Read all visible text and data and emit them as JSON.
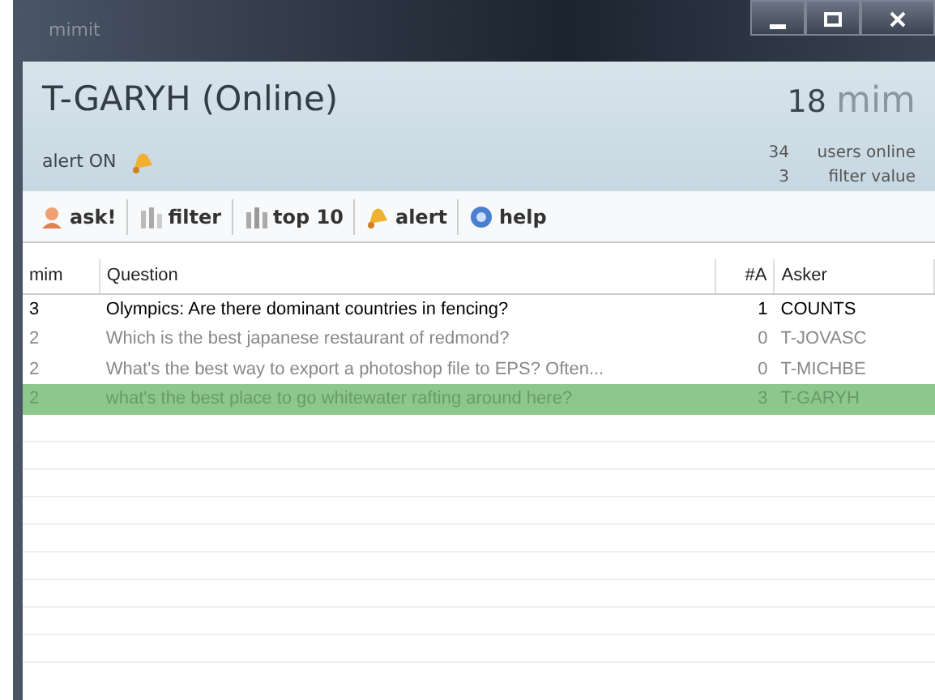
{
  "window": {
    "title": "mimit"
  },
  "header": {
    "user": "T-GARYH (Online)",
    "alert_status": "alert ON",
    "mim_count": "18",
    "logo": "mim",
    "stats": [
      {
        "value": "34",
        "label": "users online"
      },
      {
        "value": "3",
        "label": "filter value"
      }
    ]
  },
  "toolbar": [
    {
      "label": "ask!",
      "kind": "ask"
    },
    {
      "label": "filter",
      "kind": "filter"
    },
    {
      "label": "top 10",
      "kind": "top"
    },
    {
      "label": "alert",
      "kind": "alert"
    },
    {
      "label": "help",
      "kind": "help"
    }
  ],
  "table": {
    "columns": [
      "mim",
      "Question",
      "#A",
      "Asker"
    ],
    "rows": [
      {
        "mim": "3",
        "question": "Olympics: Are there dominant countries in fencing?",
        "answers": "1",
        "asker": "COUNTS",
        "unread": true,
        "selected": false
      },
      {
        "mim": "2",
        "question": "Which is the best japanese restaurant of redmond?",
        "answers": "0",
        "asker": "T-JOVASC",
        "unread": false,
        "selected": false
      },
      {
        "mim": "2",
        "question": "What's the best way to export a photoshop file to EPS? Often...",
        "answers": "0",
        "asker": "T-MICHBE",
        "unread": false,
        "selected": false
      },
      {
        "mim": "2",
        "question": "what's the best place to go whitewater rafting around here?",
        "answers": "3",
        "asker": "T-GARYH",
        "unread": false,
        "selected": true
      }
    ]
  }
}
